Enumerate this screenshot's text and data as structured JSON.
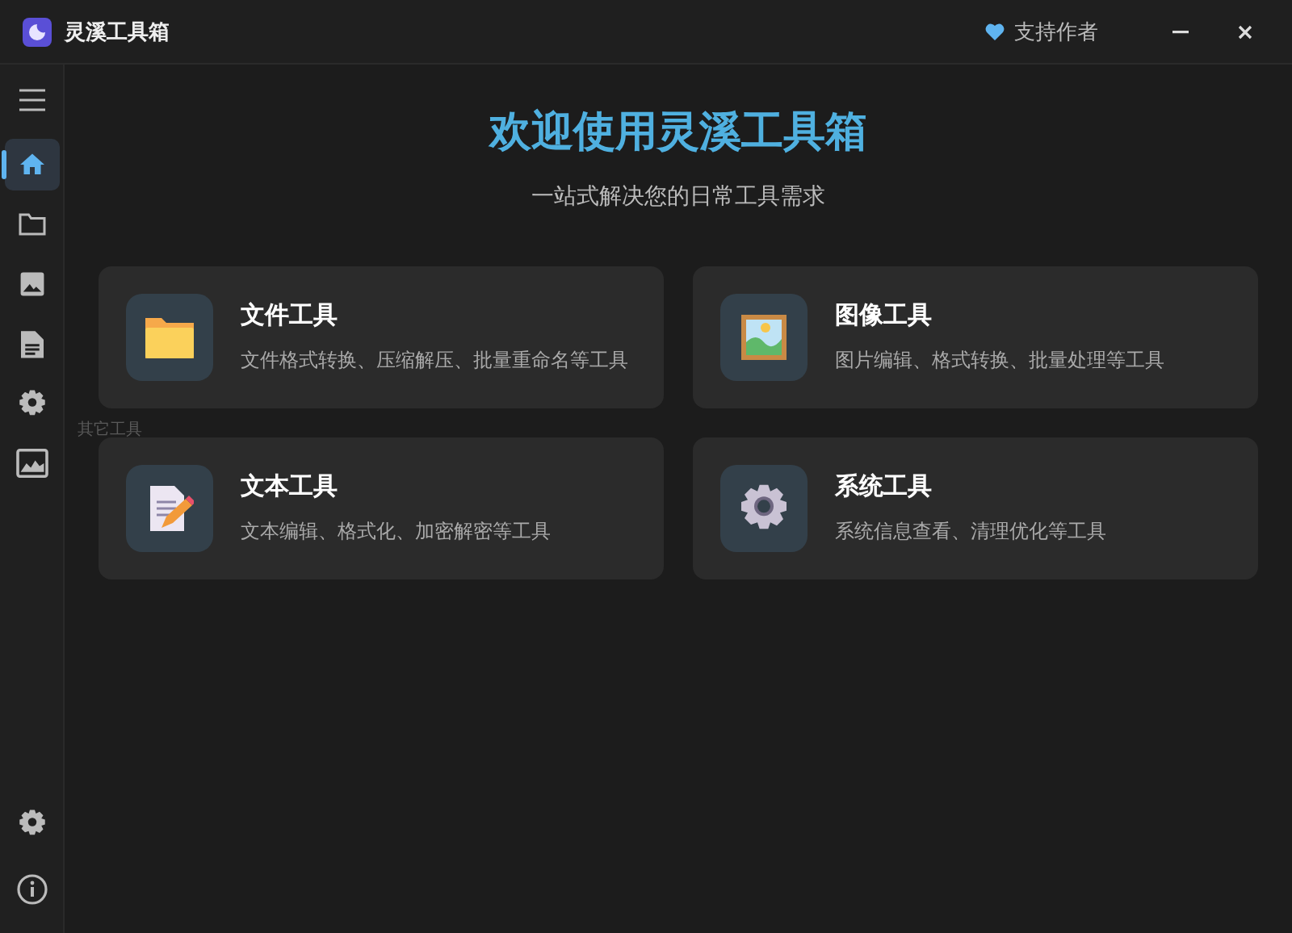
{
  "window": {
    "title": "灵溪工具箱",
    "support": "支持作者"
  },
  "sidebar": {
    "items": [
      {
        "kind": "home",
        "selected": true
      },
      {
        "kind": "folder",
        "selected": false
      },
      {
        "kind": "image",
        "selected": false
      },
      {
        "kind": "document",
        "selected": false
      },
      {
        "kind": "gear",
        "selected": false
      },
      {
        "kind": "picture",
        "selected": false
      }
    ],
    "tooltip": "其它工具",
    "bottom_items": [
      {
        "kind": "gear"
      },
      {
        "kind": "info"
      }
    ]
  },
  "hero": {
    "title": "欢迎使用灵溪工具箱",
    "subtitle": "一站式解决您的日常工具需求"
  },
  "cards": [
    {
      "kind": "folder",
      "title": "文件工具",
      "description": "文件格式转换、压缩解压、批量重命名等工具"
    },
    {
      "kind": "image",
      "title": "图像工具",
      "description": "图片编辑、格式转换、批量处理等工具"
    },
    {
      "kind": "text",
      "title": "文本工具",
      "description": "文本编辑、格式化、加密解密等工具"
    },
    {
      "kind": "system",
      "title": "系统工具",
      "description": "系统信息查看、清理优化等工具"
    }
  ]
}
